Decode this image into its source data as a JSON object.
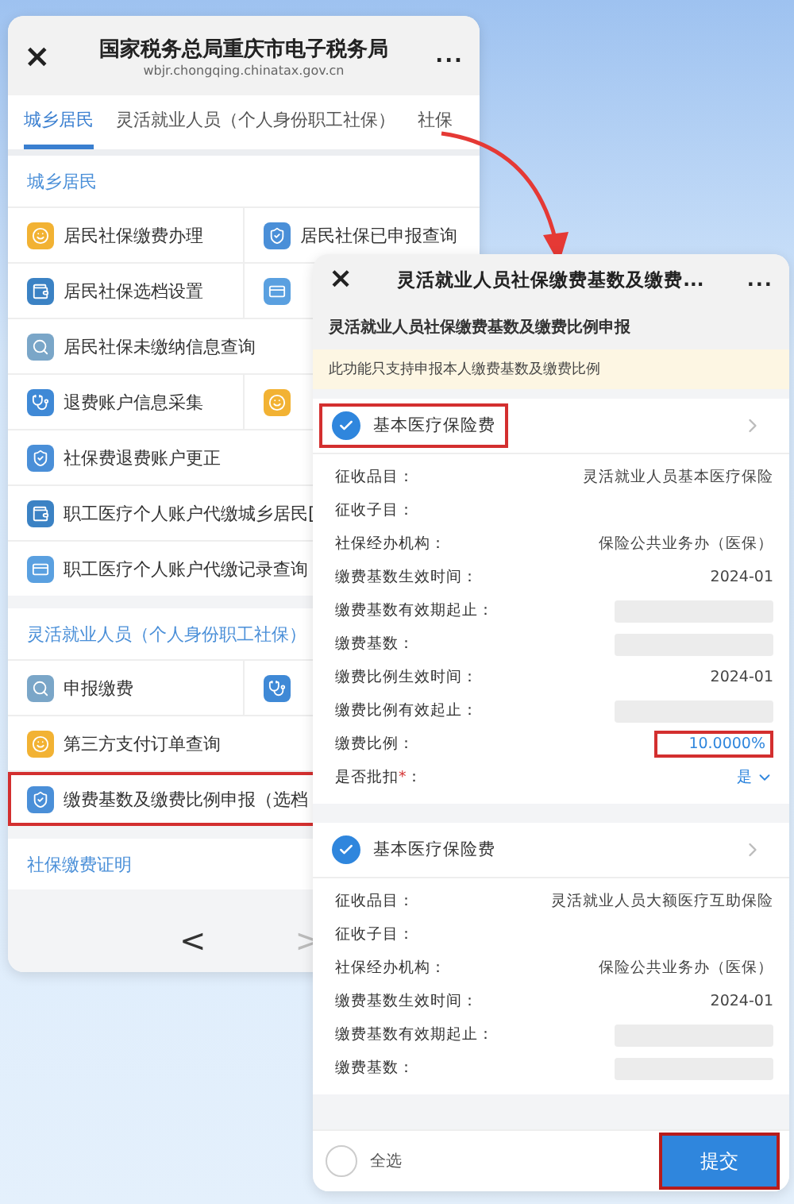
{
  "left_window": {
    "title": "国家税务总局重庆市电子税务局",
    "url": "wbjr.chongqing.chinatax.gov.cn",
    "menu": "...",
    "close": "×",
    "tabs": [
      {
        "label": "城乡居民",
        "selected": true
      },
      {
        "label": "灵活就业人员（个人身份职工社保）",
        "selected": false
      },
      {
        "label": "社保",
        "selected": false
      }
    ],
    "sections": [
      {
        "title": "城乡居民",
        "rows": [
          [
            {
              "label": "居民社保缴费办理",
              "highlighted": false
            },
            {
              "label": "居民社保已申报查询",
              "highlighted": false
            }
          ],
          [
            {
              "label": "居民社保选档设置",
              "highlighted": false
            },
            {
              "highlighted": false
            }
          ],
          [
            {
              "label": "居民社保未缴纳信息查询",
              "highlighted": false
            }
          ],
          [
            {
              "label": "退费账户信息采集",
              "highlighted": false
            },
            {
              "highlighted": false
            }
          ],
          [
            {
              "label": "社保费退费账户更正",
              "highlighted": false
            }
          ],
          [
            {
              "label": "职工医疗个人账户代缴城乡居民[",
              "highlighted": false
            }
          ],
          [
            {
              "label": "职工医疗个人账户代缴记录查询",
              "highlighted": false
            }
          ]
        ]
      },
      {
        "title": "灵活就业人员（个人身份职工社保）",
        "rows": [
          [
            {
              "label": "申报缴费",
              "highlighted": false
            },
            {
              "highlighted": false
            }
          ],
          [
            {
              "label": "第三方支付订单查询",
              "highlighted": false
            }
          ],
          [
            {
              "label": "缴费基数及缴费比例申报（选档",
              "highlighted": true
            }
          ]
        ]
      },
      {
        "title": "社保缴费证明"
      }
    ],
    "nav": [
      "<",
      ">"
    ]
  },
  "right_window": {
    "title": "灵活就业人员社保缴费基数及缴费...",
    "menu": "...",
    "close": "×",
    "subtitle": "灵活就业人员社保缴费基数及缴费比例申报",
    "notice": "此功能只支持申报本人缴费基数及缴费比例",
    "cards": [
      {
        "name": "基本医疗保险费",
        "checked": true,
        "highlighted": true,
        "fields": [
          {
            "kind": "text",
            "label": "征收品目：",
            "value": "灵活就业人员基本医疗保险"
          },
          {
            "kind": "text",
            "label": "征收子目："
          },
          {
            "kind": "text",
            "label": "社保经办机构：",
            "value": "保险公共业务办（医保）"
          },
          {
            "kind": "text",
            "label": "缴费基数生效时间：",
            "value": "2024-01"
          },
          {
            "kind": "redacted",
            "label": "缴费基数有效期起止："
          },
          {
            "kind": "redacted",
            "label": "缴费基数："
          },
          {
            "kind": "text",
            "label": "缴费比例生效时间：",
            "value": "2024-01"
          },
          {
            "kind": "redacted",
            "label": "缴费比例有效起止："
          },
          {
            "kind": "highlight",
            "label": "缴费比例：",
            "value": "10.0000%"
          },
          {
            "kind": "select",
            "label": "是否批扣",
            "mark": "*",
            "colon": "：",
            "value": "是"
          }
        ]
      },
      {
        "name": "基本医疗保险费",
        "checked": true,
        "highlighted": false,
        "fields": [
          {
            "kind": "text",
            "label": "征收品目：",
            "value": "灵活就业人员大额医疗互助保险"
          },
          {
            "kind": "text",
            "label": "征收子目："
          },
          {
            "kind": "text",
            "label": "社保经办机构：",
            "value": "保险公共业务办（医保）"
          },
          {
            "kind": "text",
            "label": "缴费基数生效时间：",
            "value": "2024-01"
          },
          {
            "kind": "redacted",
            "label": "缴费基数有效期起止："
          },
          {
            "kind": "redacted",
            "label": "缴费基数："
          }
        ]
      }
    ],
    "select_all": {
      "label": "全选",
      "checked": false
    },
    "submit": {
      "label": "提交",
      "highlighted": true
    }
  }
}
